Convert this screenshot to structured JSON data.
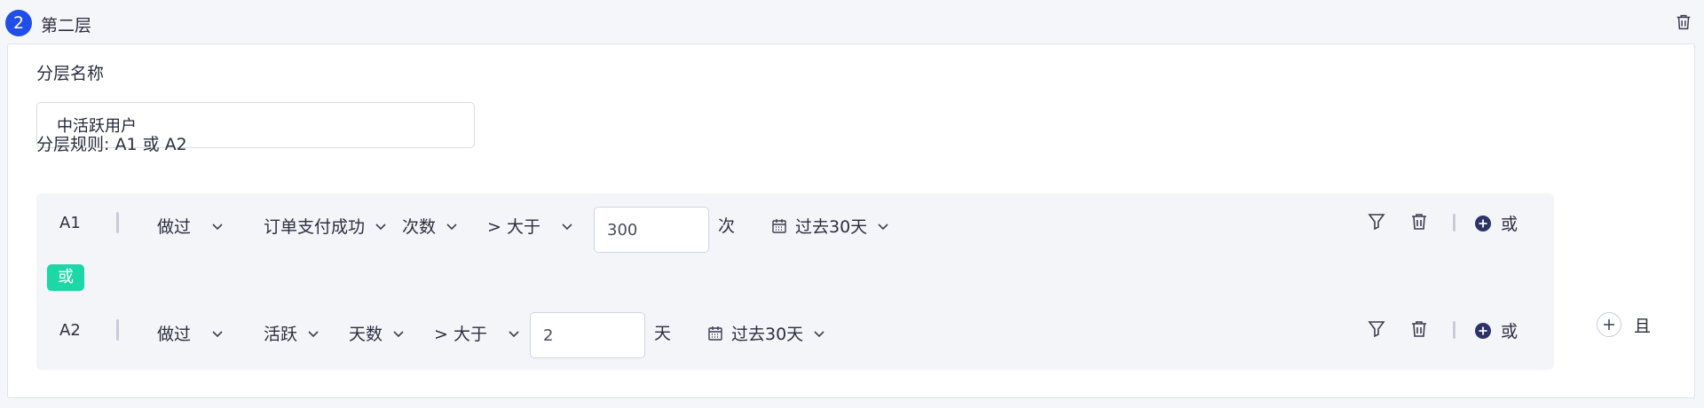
{
  "layer": {
    "number": "2",
    "title": "第二层"
  },
  "form": {
    "name_label": "分层名称",
    "name_value": "中活跃用户",
    "rule_label": "分层规则: A1 或 A2"
  },
  "conditions": [
    {
      "id": "A1",
      "action": "做过",
      "event": "订单支付成功",
      "metric": "次数",
      "operator": "> 大于",
      "value": "300",
      "unit": "次",
      "date_range": "过去30天",
      "or_label": "或"
    },
    {
      "id": "A2",
      "action": "做过",
      "event": "活跃",
      "metric": "天数",
      "operator": "> 大于",
      "value": "2",
      "unit": "天",
      "date_range": "过去30天",
      "or_label": "或"
    }
  ],
  "connector": "或",
  "and_label": "且",
  "colors": {
    "accent": "#1f4fe8",
    "or_badge": "#1ed6a6"
  }
}
